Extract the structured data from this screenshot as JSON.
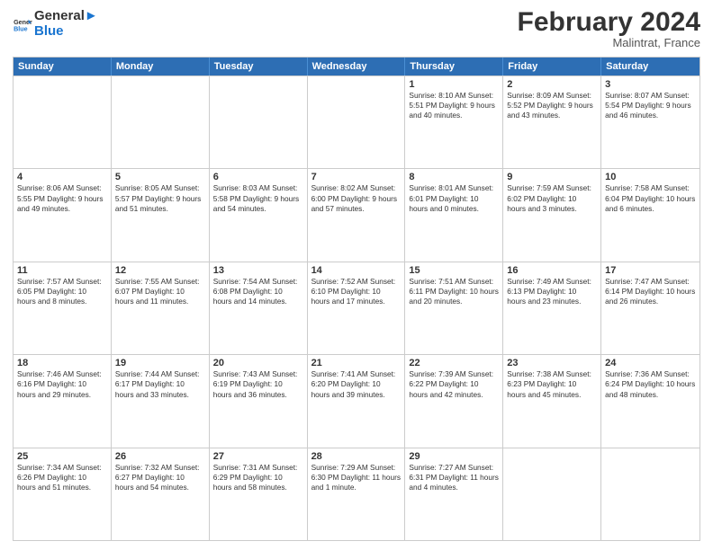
{
  "logo": {
    "line1": "General",
    "line2": "Blue"
  },
  "title": "February 2024",
  "subtitle": "Malintrat, France",
  "headers": [
    "Sunday",
    "Monday",
    "Tuesday",
    "Wednesday",
    "Thursday",
    "Friday",
    "Saturday"
  ],
  "rows": [
    [
      {
        "day": "",
        "info": "",
        "empty": true
      },
      {
        "day": "",
        "info": "",
        "empty": true
      },
      {
        "day": "",
        "info": "",
        "empty": true
      },
      {
        "day": "",
        "info": "",
        "empty": true
      },
      {
        "day": "1",
        "info": "Sunrise: 8:10 AM\nSunset: 5:51 PM\nDaylight: 9 hours\nand 40 minutes."
      },
      {
        "day": "2",
        "info": "Sunrise: 8:09 AM\nSunset: 5:52 PM\nDaylight: 9 hours\nand 43 minutes."
      },
      {
        "day": "3",
        "info": "Sunrise: 8:07 AM\nSunset: 5:54 PM\nDaylight: 9 hours\nand 46 minutes."
      }
    ],
    [
      {
        "day": "4",
        "info": "Sunrise: 8:06 AM\nSunset: 5:55 PM\nDaylight: 9 hours\nand 49 minutes."
      },
      {
        "day": "5",
        "info": "Sunrise: 8:05 AM\nSunset: 5:57 PM\nDaylight: 9 hours\nand 51 minutes."
      },
      {
        "day": "6",
        "info": "Sunrise: 8:03 AM\nSunset: 5:58 PM\nDaylight: 9 hours\nand 54 minutes."
      },
      {
        "day": "7",
        "info": "Sunrise: 8:02 AM\nSunset: 6:00 PM\nDaylight: 9 hours\nand 57 minutes."
      },
      {
        "day": "8",
        "info": "Sunrise: 8:01 AM\nSunset: 6:01 PM\nDaylight: 10 hours\nand 0 minutes."
      },
      {
        "day": "9",
        "info": "Sunrise: 7:59 AM\nSunset: 6:02 PM\nDaylight: 10 hours\nand 3 minutes."
      },
      {
        "day": "10",
        "info": "Sunrise: 7:58 AM\nSunset: 6:04 PM\nDaylight: 10 hours\nand 6 minutes."
      }
    ],
    [
      {
        "day": "11",
        "info": "Sunrise: 7:57 AM\nSunset: 6:05 PM\nDaylight: 10 hours\nand 8 minutes."
      },
      {
        "day": "12",
        "info": "Sunrise: 7:55 AM\nSunset: 6:07 PM\nDaylight: 10 hours\nand 11 minutes."
      },
      {
        "day": "13",
        "info": "Sunrise: 7:54 AM\nSunset: 6:08 PM\nDaylight: 10 hours\nand 14 minutes."
      },
      {
        "day": "14",
        "info": "Sunrise: 7:52 AM\nSunset: 6:10 PM\nDaylight: 10 hours\nand 17 minutes."
      },
      {
        "day": "15",
        "info": "Sunrise: 7:51 AM\nSunset: 6:11 PM\nDaylight: 10 hours\nand 20 minutes."
      },
      {
        "day": "16",
        "info": "Sunrise: 7:49 AM\nSunset: 6:13 PM\nDaylight: 10 hours\nand 23 minutes."
      },
      {
        "day": "17",
        "info": "Sunrise: 7:47 AM\nSunset: 6:14 PM\nDaylight: 10 hours\nand 26 minutes."
      }
    ],
    [
      {
        "day": "18",
        "info": "Sunrise: 7:46 AM\nSunset: 6:16 PM\nDaylight: 10 hours\nand 29 minutes."
      },
      {
        "day": "19",
        "info": "Sunrise: 7:44 AM\nSunset: 6:17 PM\nDaylight: 10 hours\nand 33 minutes."
      },
      {
        "day": "20",
        "info": "Sunrise: 7:43 AM\nSunset: 6:19 PM\nDaylight: 10 hours\nand 36 minutes."
      },
      {
        "day": "21",
        "info": "Sunrise: 7:41 AM\nSunset: 6:20 PM\nDaylight: 10 hours\nand 39 minutes."
      },
      {
        "day": "22",
        "info": "Sunrise: 7:39 AM\nSunset: 6:22 PM\nDaylight: 10 hours\nand 42 minutes."
      },
      {
        "day": "23",
        "info": "Sunrise: 7:38 AM\nSunset: 6:23 PM\nDaylight: 10 hours\nand 45 minutes."
      },
      {
        "day": "24",
        "info": "Sunrise: 7:36 AM\nSunset: 6:24 PM\nDaylight: 10 hours\nand 48 minutes."
      }
    ],
    [
      {
        "day": "25",
        "info": "Sunrise: 7:34 AM\nSunset: 6:26 PM\nDaylight: 10 hours\nand 51 minutes."
      },
      {
        "day": "26",
        "info": "Sunrise: 7:32 AM\nSunset: 6:27 PM\nDaylight: 10 hours\nand 54 minutes."
      },
      {
        "day": "27",
        "info": "Sunrise: 7:31 AM\nSunset: 6:29 PM\nDaylight: 10 hours\nand 58 minutes."
      },
      {
        "day": "28",
        "info": "Sunrise: 7:29 AM\nSunset: 6:30 PM\nDaylight: 11 hours\nand 1 minute."
      },
      {
        "day": "29",
        "info": "Sunrise: 7:27 AM\nSunset: 6:31 PM\nDaylight: 11 hours\nand 4 minutes."
      },
      {
        "day": "",
        "info": "",
        "empty": true
      },
      {
        "day": "",
        "info": "",
        "empty": true
      }
    ]
  ]
}
